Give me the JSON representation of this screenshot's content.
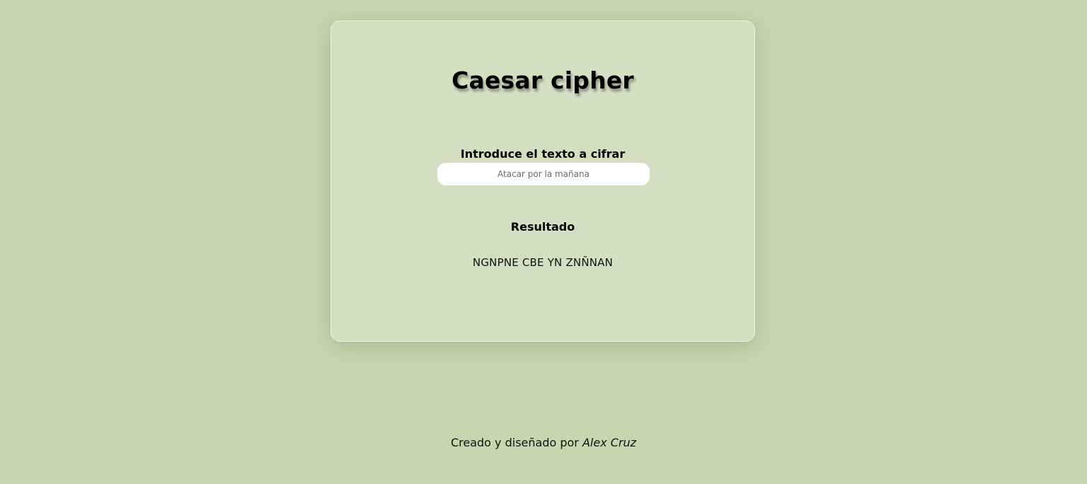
{
  "card": {
    "title": "Caesar cipher",
    "input_label": "Introduce el texto a cifrar",
    "input_placeholder": "Atacar por la mañana",
    "input_value": "",
    "result_label": "Resultado",
    "result_value": "NGNPNE CBE YN ZNÑNAN"
  },
  "footer": {
    "prefix": "Creado y diseñado por",
    "author": "Alex Cruz"
  },
  "colors": {
    "background": "#c8d5af",
    "card": "#d4dfc2",
    "input": "#ffffff"
  }
}
